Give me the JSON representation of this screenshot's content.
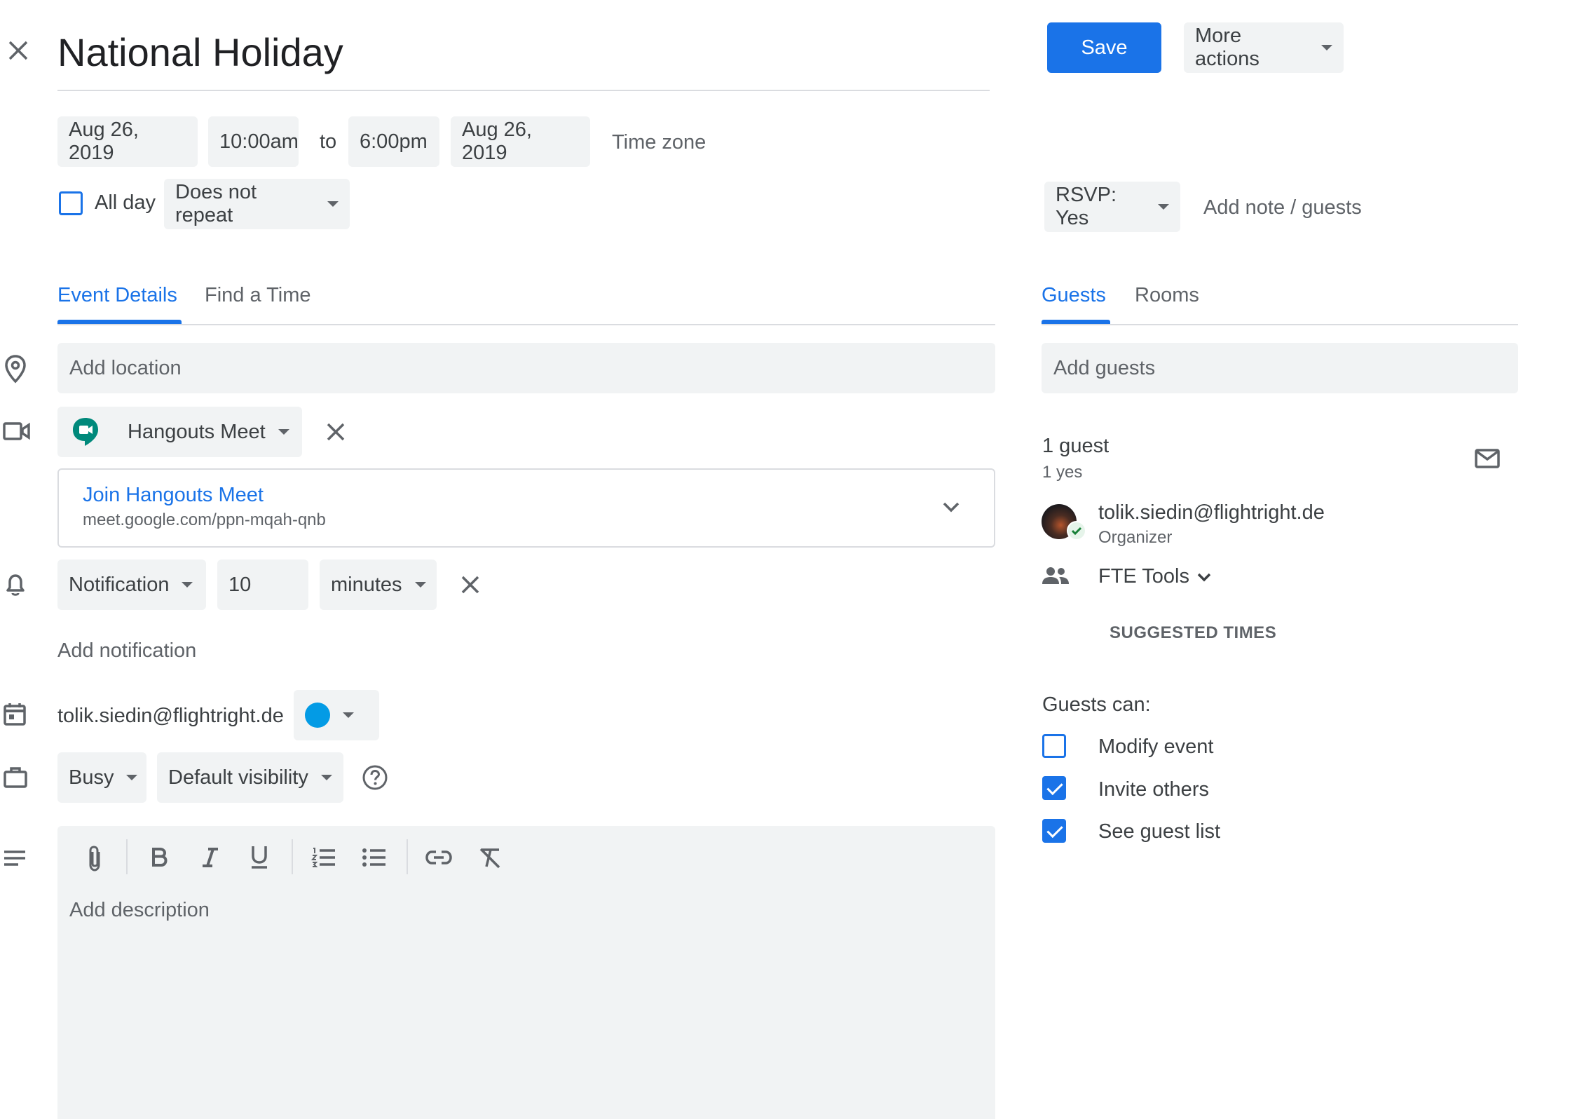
{
  "event": {
    "title": "National Holiday",
    "start_date": "Aug 26, 2019",
    "start_time": "10:00am",
    "to_label": "to",
    "end_time": "6:00pm",
    "end_date": "Aug 26, 2019",
    "time_zone_label": "Time zone",
    "all_day_label": "All day",
    "all_day_checked": false,
    "repeat": "Does not repeat"
  },
  "actions": {
    "save_label": "Save",
    "more_actions_label": "More actions",
    "rsvp_label": "RSVP: Yes",
    "add_note_label": "Add note / guests"
  },
  "left_tabs": [
    {
      "label": "Event Details",
      "active": true
    },
    {
      "label": "Find a Time",
      "active": false
    }
  ],
  "details": {
    "location_placeholder": "Add location",
    "conference_type": "Hangouts Meet",
    "join_label": "Join Hangouts Meet",
    "join_url": "meet.google.com/ppn-mqah-qnb",
    "notification_type": "Notification",
    "notification_value": "10",
    "notification_unit": "minutes",
    "add_notification_label": "Add notification",
    "calendar_owner": "tolik.siedin@flightright.de",
    "calendar_color": "#039be5",
    "availability": "Busy",
    "visibility": "Default visibility",
    "description_placeholder": "Add description"
  },
  "right_tabs": [
    {
      "label": "Guests",
      "active": true
    },
    {
      "label": "Rooms",
      "active": false
    }
  ],
  "guests": {
    "add_placeholder": "Add guests",
    "count_label": "1 guest",
    "summary": "1 yes",
    "list": [
      {
        "email": "tolik.siedin@flightright.de",
        "role": "Organizer",
        "status": "accepted"
      }
    ],
    "group_label": "FTE Tools",
    "suggested_times_label": "SUGGESTED TIMES",
    "permissions_title": "Guests can:",
    "permissions": [
      {
        "label": "Modify event",
        "checked": false
      },
      {
        "label": "Invite others",
        "checked": true
      },
      {
        "label": "See guest list",
        "checked": true
      }
    ]
  },
  "colors": {
    "accent": "#1a73e8",
    "field_bg": "#f1f3f4",
    "meet_green": "#00897b"
  },
  "icons": [
    "close-icon",
    "location-pin-icon",
    "video-icon",
    "bell-icon",
    "calendar-icon",
    "briefcase-icon",
    "description-icon",
    "attachment-icon",
    "bold-icon",
    "italic-icon",
    "underline-icon",
    "numbered-list-icon",
    "bulleted-list-icon",
    "link-icon",
    "clear-format-icon",
    "mail-icon",
    "people-icon",
    "help-icon",
    "chevron-down-icon",
    "hangouts-meet-icon"
  ]
}
